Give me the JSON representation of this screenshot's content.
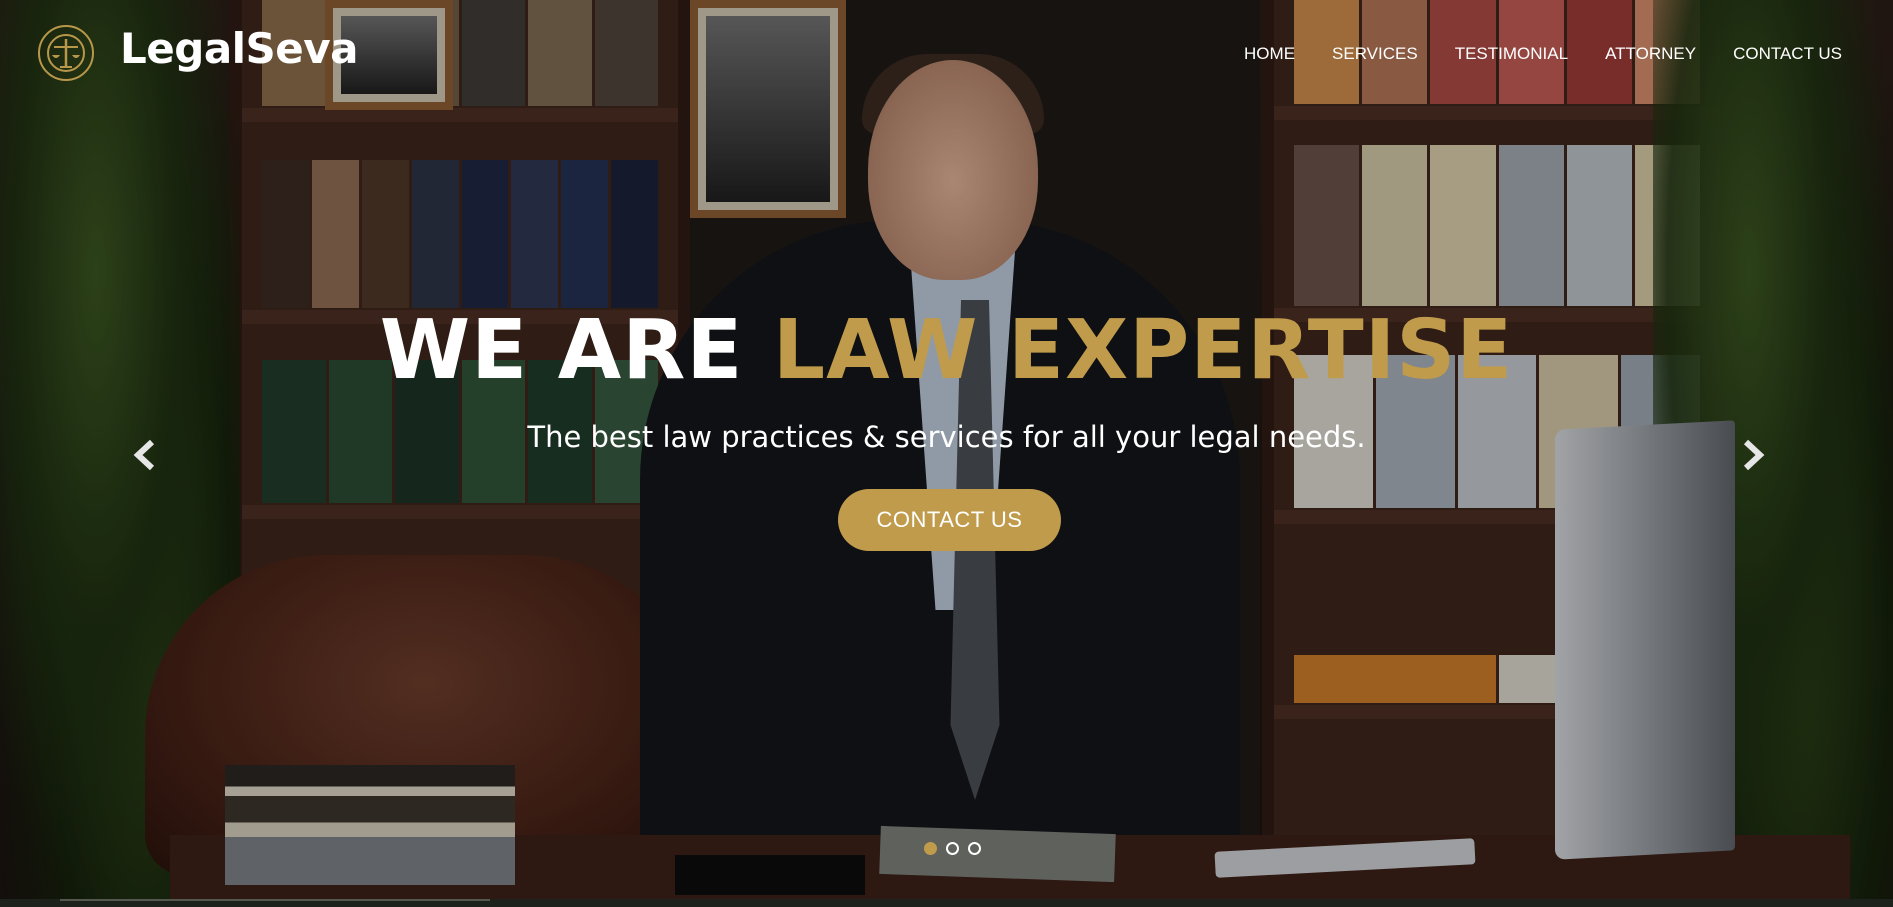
{
  "brand": {
    "name": "LegalSeva",
    "logo_icon": "scales-of-justice-icon",
    "accent_color": "#bf9b4b"
  },
  "nav": {
    "items": [
      {
        "label": "HOME"
      },
      {
        "label": "SERVICES"
      },
      {
        "label": "TESTIMONIAL"
      },
      {
        "label": "ATTORNEY"
      },
      {
        "label": "CONTACT US"
      }
    ]
  },
  "hero": {
    "title_white": "WE ARE",
    "title_gold": "LAW EXPERTISE",
    "subtitle": "The best law practices & services for all your legal needs.",
    "cta_label": "CONTACT US"
  },
  "carousel": {
    "prev_icon": "chevron-left-icon",
    "next_icon": "chevron-right-icon",
    "slides": 3,
    "active_slide": 1
  }
}
